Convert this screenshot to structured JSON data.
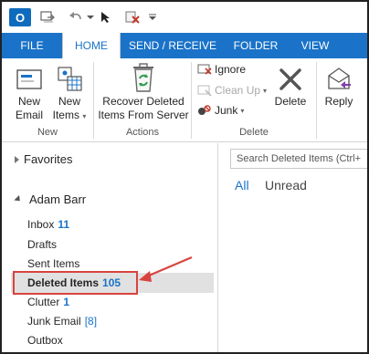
{
  "quick_access": {
    "app_icon": "outlook-icon",
    "app_letter": "O",
    "icons": [
      "send-receive-icon",
      "undo-icon",
      "dropdown-arrow-icon",
      "delete-folder-icon",
      "customize-icon"
    ]
  },
  "tabs": [
    {
      "label": "FILE",
      "active": false
    },
    {
      "label": "HOME",
      "active": true
    },
    {
      "label": "SEND / RECEIVE",
      "active": false
    },
    {
      "label": "FOLDER",
      "active": false
    },
    {
      "label": "VIEW",
      "active": false
    }
  ],
  "ribbon": {
    "new_email": {
      "line1": "New",
      "line2": "Email"
    },
    "new_items": {
      "line1": "New",
      "line2": "Items"
    },
    "new_group": "New",
    "recover": {
      "line1": "Recover Deleted",
      "line2": "Items From Server"
    },
    "actions_group": "Actions",
    "ignore": "Ignore",
    "clean_up": "Clean Up",
    "junk": "Junk",
    "delete": "Delete",
    "delete_group": "Delete",
    "reply": "Reply"
  },
  "nav": {
    "favorites": "Favorites",
    "account": "Adam Barr",
    "folders": [
      {
        "name": "Inbox",
        "count": "11"
      },
      {
        "name": "Drafts",
        "count": ""
      },
      {
        "name": "Sent Items",
        "count": ""
      },
      {
        "name": "Deleted Items",
        "count": "105"
      },
      {
        "name": "Clutter",
        "count": "1"
      },
      {
        "name": "Junk Email",
        "count": "[8]"
      },
      {
        "name": "Outbox",
        "count": ""
      }
    ]
  },
  "list": {
    "search_placeholder": "Search Deleted Items (Ctrl+",
    "filter_all": "All",
    "filter_unread": "Unread"
  },
  "colors": {
    "accent": "#1a73c8",
    "highlight": "#d9433f"
  }
}
